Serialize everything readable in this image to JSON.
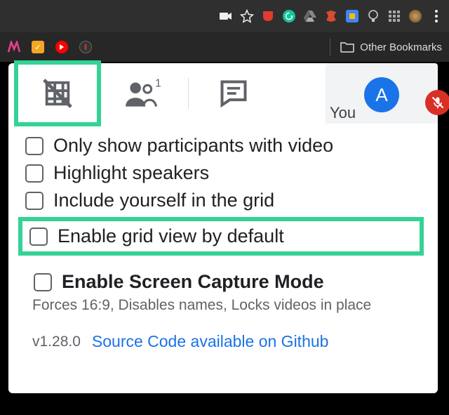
{
  "browser": {
    "other_bookmarks_label": "Other Bookmarks"
  },
  "tabs": {
    "people_count": "1"
  },
  "participant": {
    "you_label": "You",
    "avatar_letter": "A"
  },
  "options": {
    "only_video": "Only show participants with video",
    "highlight_speakers": "Highlight speakers",
    "include_yourself": "Include yourself in the grid",
    "enable_default": "Enable grid view by default",
    "screen_capture": "Enable Screen Capture Mode",
    "screen_capture_caption": "Forces 16:9, Disables names, Locks videos in place"
  },
  "footer": {
    "version": "v1.28.0",
    "source_link": "Source Code available on Github"
  }
}
